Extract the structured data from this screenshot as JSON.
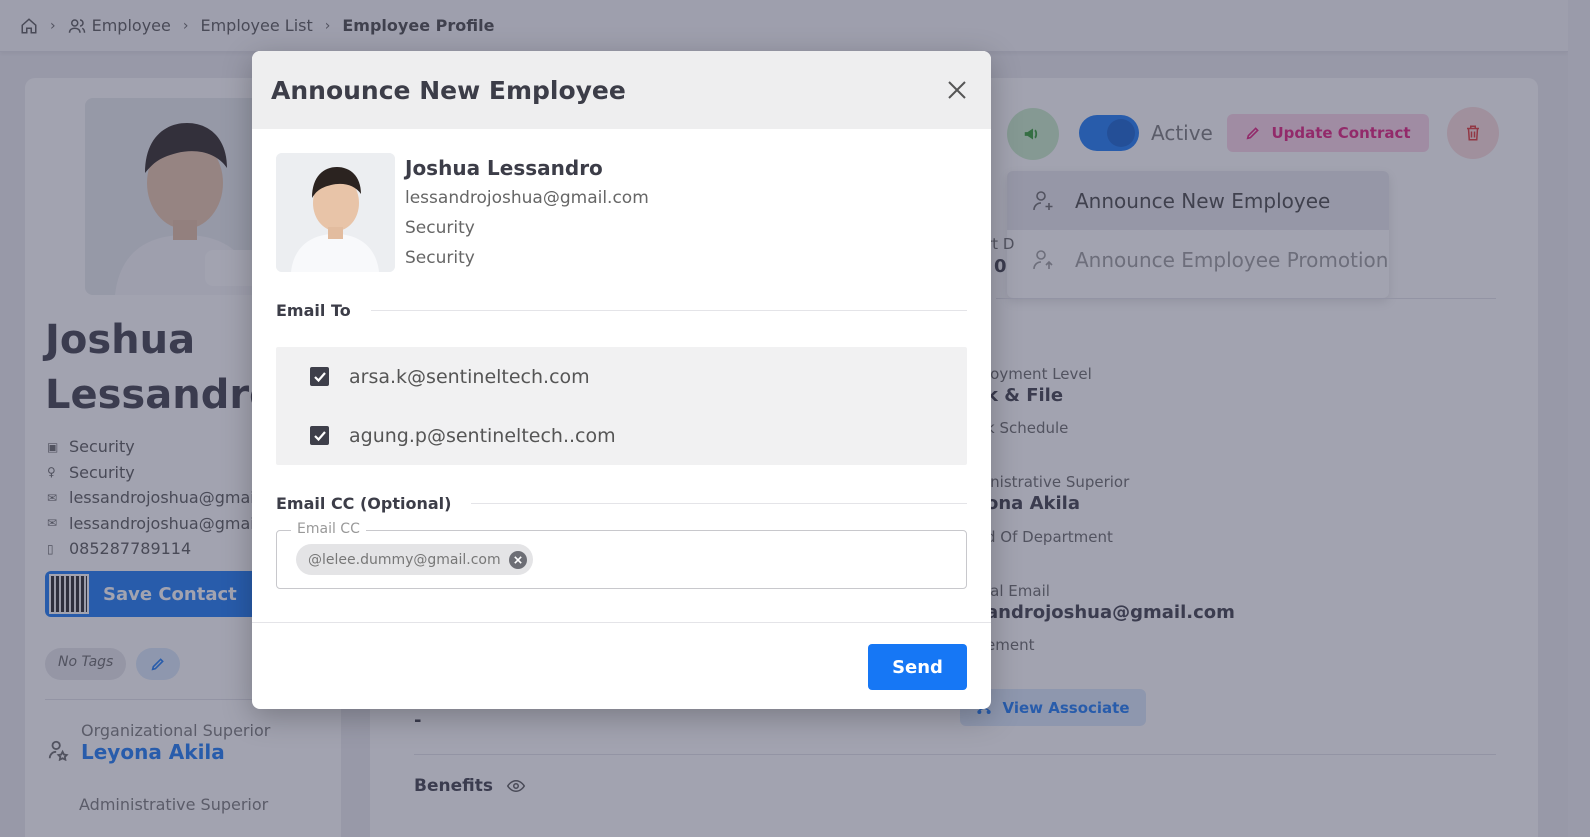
{
  "breadcrumb": {
    "items": [
      "Employee",
      "Employee List"
    ],
    "current": "Employee Profile"
  },
  "profile": {
    "first_name": "Joshua",
    "last_name": "Lessandro",
    "department": "Security",
    "position": "Security",
    "email_personal": "lessandrojoshua@gmai",
    "email_work": "lessandrojoshua@gmai",
    "phone": "085287789114",
    "save_contact_label": "Save Contact",
    "tags_label": "No Tags",
    "org_superior_label": "Organizational Superior",
    "org_superior_value": "Leyona Akila",
    "admin_superior_label": "Administrative Superior"
  },
  "actions": {
    "active_label": "Active",
    "update_contract_label": "Update Contract"
  },
  "dropdown": {
    "items": [
      {
        "label": "Announce New Employee"
      },
      {
        "label": "Announce Employee Promotion"
      }
    ]
  },
  "details": {
    "start_date_label": "rt D",
    "start_date_value": "0",
    "employment_level_label": "loyment Level",
    "employment_level_value": "k & File",
    "work_schedule_label": "k Schedule",
    "admin_superior_label": "inistrative Superior",
    "admin_superior_value": "ona Akila",
    "head_of_dept_label": "d Of Department",
    "official_email_label": "ial Email",
    "official_email_value": "androjoshua@gmail.com",
    "placement_label": "ement",
    "dash_value": "-",
    "view_associate_label": "View Associate",
    "benefits_label": "Benefits"
  },
  "modal": {
    "title": "Announce New Employee",
    "employee": {
      "name": "Joshua Lessandro",
      "email": "lessandrojoshua@gmail.com",
      "department": "Security",
      "position": "Security"
    },
    "email_to_title": "Email To",
    "recipients": [
      {
        "email": "arsa.k@sentineltech.com",
        "checked": true
      },
      {
        "email": "agung.p@sentineltech..com",
        "checked": true
      }
    ],
    "email_cc_title": "Email CC (Optional)",
    "cc_field_label": "Email CC",
    "cc_chip": "@lelee.dummy@gmail.com",
    "send_label": "Send"
  },
  "colors": {
    "primary": "#1677f5",
    "danger": "#e03131",
    "pink": "#e0177a",
    "success": "#2e9a2e"
  }
}
